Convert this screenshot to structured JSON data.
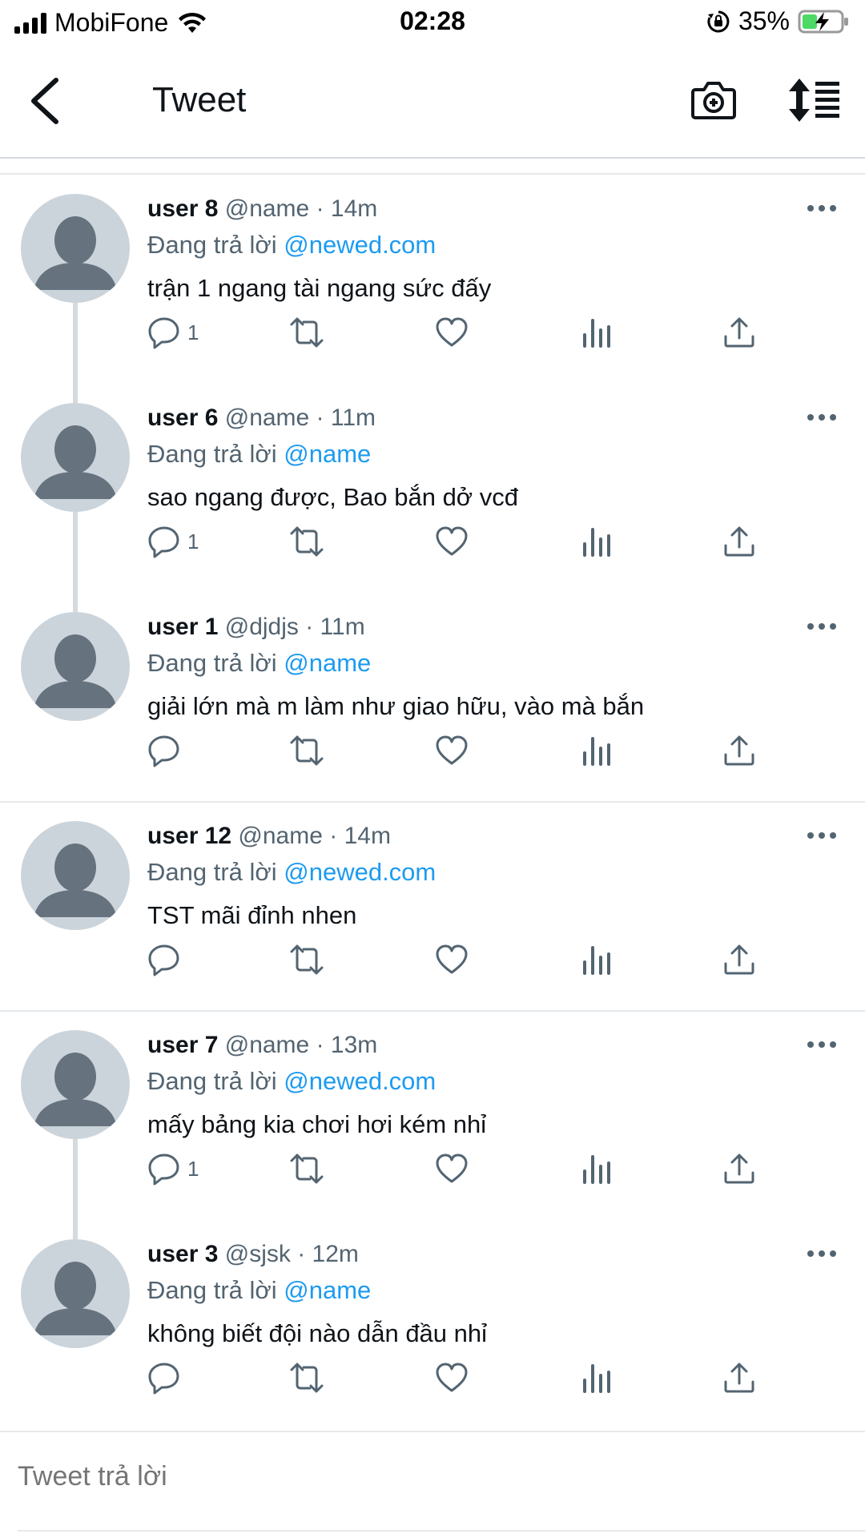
{
  "status_bar": {
    "carrier": "MobiFone",
    "time": "02:28",
    "battery": "35%"
  },
  "nav": {
    "title": "Tweet",
    "back_icon": "chevron-left-icon",
    "camera_icon": "camera-plus-icon",
    "sort_icon": "sort-icon"
  },
  "tweets": [
    {
      "name": "user 8",
      "handle": "@name",
      "time": "· 14m",
      "reply_prefix": "Đang trả lời",
      "reply_to": "@newed.com",
      "text": "trận 1 ngang tài ngang sức đấy",
      "reply_count": "1"
    },
    {
      "name": "user 6",
      "handle": "@name",
      "time": "· 11m",
      "reply_prefix": "Đang trả lời",
      "reply_to": "@name",
      "text": "sao ngang được, Bao bắn dở vcđ",
      "reply_count": "1"
    },
    {
      "name": "user 1",
      "handle": "@djdjs",
      "time": "· 11m",
      "reply_prefix": "Đang trả lời",
      "reply_to": "@name",
      "text": "giải lớn mà m làm như giao hữu, vào mà bắn",
      "reply_count": ""
    },
    {
      "name": "user 12",
      "handle": "@name",
      "time": "· 14m",
      "reply_prefix": "Đang trả lời",
      "reply_to": "@newed.com",
      "text": "TST mãi đỉnh nhen",
      "reply_count": ""
    },
    {
      "name": "user 7",
      "handle": "@name",
      "time": "· 13m",
      "reply_prefix": "Đang trả lời",
      "reply_to": "@newed.com",
      "text": "mấy bảng kia chơi hơi kém nhỉ",
      "reply_count": "1"
    },
    {
      "name": "user 3",
      "handle": "@sjsk",
      "time": "· 12m",
      "reply_prefix": "Đang trả lời",
      "reply_to": "@name",
      "text": "không biết đội nào dẫn đầu nhỉ",
      "reply_count": ""
    }
  ],
  "reply_bar": {
    "placeholder": "Tweet trả lời"
  },
  "colors": {
    "accent": "#1d9bf0",
    "secondary_text": "#536471",
    "avatar_bg": "#ccd4db",
    "avatar_fg": "#66737f"
  }
}
